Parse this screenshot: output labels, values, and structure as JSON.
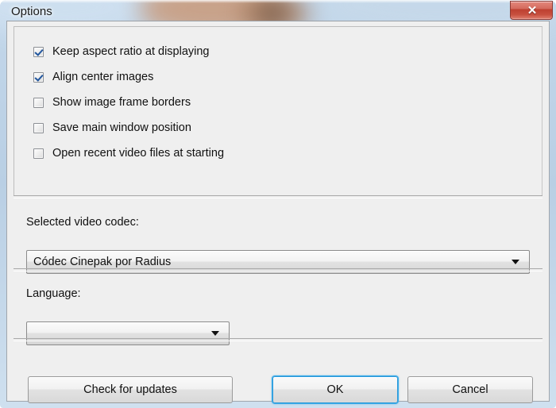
{
  "window": {
    "title": "Options",
    "close_icon": "close-icon",
    "close_glyph": "✕",
    "accent_color": "#3aabe8",
    "close_button_color": "#c8503f",
    "panel_color": "#efefef"
  },
  "options": {
    "checkboxes": [
      {
        "label": "Keep aspect ratio at displaying",
        "checked": true
      },
      {
        "label": "Align center images",
        "checked": true
      },
      {
        "label": "Show image frame borders",
        "checked": false
      },
      {
        "label": "Save main window position",
        "checked": false
      },
      {
        "label": "Open recent video files at starting",
        "checked": false
      }
    ]
  },
  "codec": {
    "label": "Selected video codec:",
    "value": "Códec Cinepak por Radius",
    "arrow_icon": "chevron-down-icon"
  },
  "language": {
    "label": "Language:",
    "value": "",
    "arrow_icon": "chevron-down-icon"
  },
  "buttons": {
    "check_updates": "Check for updates",
    "ok": "OK",
    "cancel": "Cancel"
  }
}
